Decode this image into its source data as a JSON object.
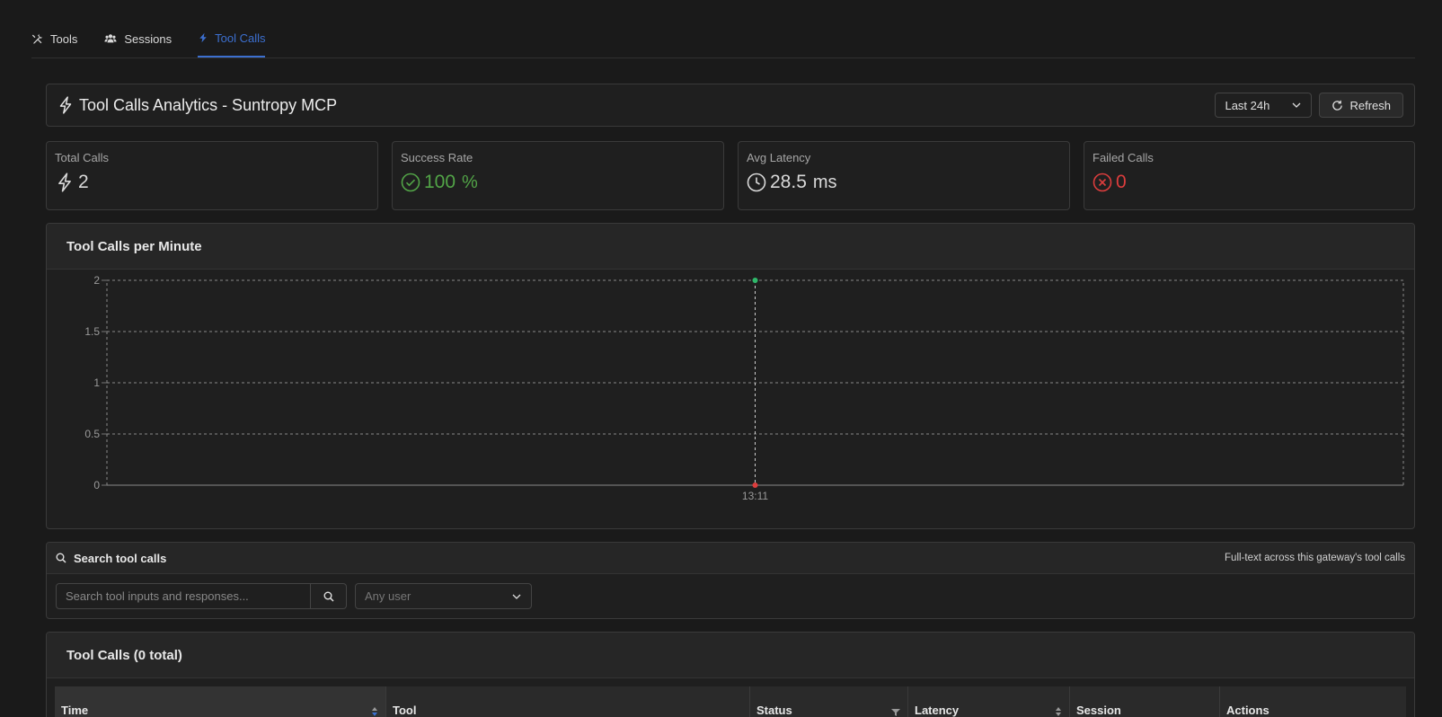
{
  "tabs": [
    {
      "label": "Tools",
      "icon": "tools-icon"
    },
    {
      "label": "Sessions",
      "icon": "users-icon"
    },
    {
      "label": "Tool Calls",
      "icon": "lightning-icon",
      "active": true
    }
  ],
  "header": {
    "title": "Tool Calls Analytics - Suntropy MCP",
    "range_value": "Last 24h",
    "refresh_label": "Refresh"
  },
  "stats": {
    "total": {
      "label": "Total Calls",
      "value": "2"
    },
    "success": {
      "label": "Success Rate",
      "value": "100",
      "unit": "%"
    },
    "latency": {
      "label": "Avg Latency",
      "value": "28.5",
      "unit": "ms"
    },
    "failed": {
      "label": "Failed Calls",
      "value": "0"
    }
  },
  "colors": {
    "accent": "#3c6fcf",
    "success": "#52a447",
    "error": "#dc3d3d"
  },
  "chart_title": "Tool Calls per Minute",
  "chart_data": {
    "type": "line",
    "title": "Tool Calls per Minute",
    "x": [
      "13:11"
    ],
    "series": [
      {
        "values": [
          2
        ],
        "color": "#2fb86a"
      },
      {
        "values": [
          0
        ],
        "color": "#dc3d3d"
      }
    ],
    "yticks": [
      "0",
      "0.5",
      "1",
      "1.5",
      "2"
    ],
    "ylim": [
      0,
      2
    ],
    "grid": true
  },
  "search": {
    "title": "Search tool calls",
    "hint": "Full-text across this gateway's tool calls",
    "placeholder": "Search tool inputs and responses...",
    "user_placeholder": "Any user"
  },
  "table": {
    "title": "Tool Calls (0 total)",
    "columns": [
      "Time",
      "Tool",
      "Status",
      "Latency",
      "Session",
      "Actions"
    ]
  }
}
